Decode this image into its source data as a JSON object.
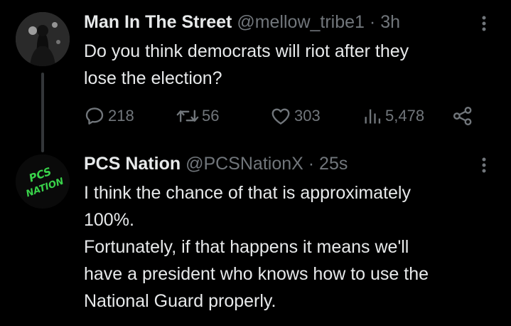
{
  "tweets": [
    {
      "display_name": "Man In The Street",
      "handle": "@mellow_tribe1",
      "separator": "·",
      "time": "3h",
      "text_lines": [
        "Do you think democrats will riot after they",
        "lose the election?"
      ],
      "avatar_icon": "hooded-figure-avatar-icon",
      "actions": {
        "replies": "218",
        "reposts": "56",
        "likes": "303",
        "views": "5,478"
      }
    },
    {
      "display_name": "PCS Nation",
      "handle": "@PCSNationX",
      "separator": "·",
      "time": "25s",
      "avatar_text_1": "PCS",
      "avatar_text_2": "NATION",
      "text_lines": [
        "I think the chance of that is approximately",
        "100%.",
        "Fortunately, if that happens it means we'll",
        "have a president who knows how to use the",
        "National Guard properly."
      ]
    }
  ],
  "colors": {
    "background": "#000000",
    "primary_text": "#e7e9ea",
    "secondary_text": "#71767b",
    "thread_line": "#333639",
    "pcs_green": "#39d34a"
  }
}
